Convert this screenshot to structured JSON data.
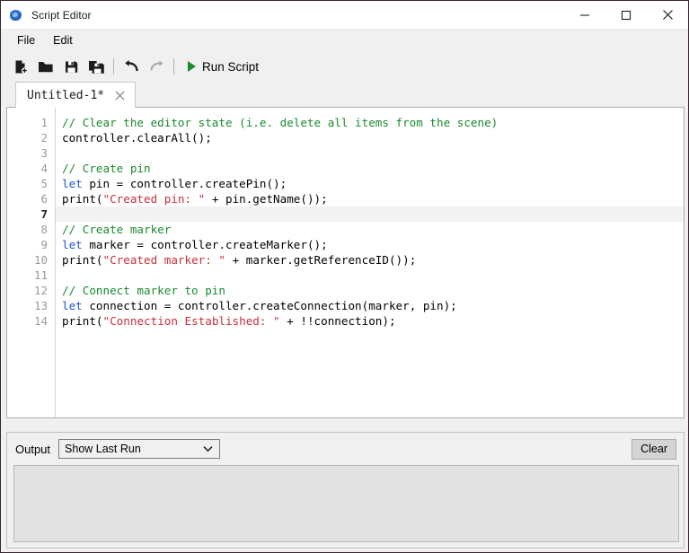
{
  "window": {
    "title": "Script Editor",
    "app_icon": "app-blob-icon",
    "controls": [
      {
        "name": "minimize",
        "glyph": "minimize-icon"
      },
      {
        "name": "maximize",
        "glyph": "maximize-icon"
      },
      {
        "name": "close",
        "glyph": "close-icon"
      }
    ]
  },
  "menubar": {
    "items": [
      {
        "label": "File"
      },
      {
        "label": "Edit"
      }
    ]
  },
  "toolbar": {
    "buttons": [
      {
        "name": "new-file-icon",
        "title": "New"
      },
      {
        "name": "open-folder-icon",
        "title": "Open"
      },
      {
        "name": "save-icon",
        "title": "Save"
      },
      {
        "name": "save-as-icon",
        "title": "Save As"
      },
      {
        "name": "undo-icon",
        "title": "Undo"
      },
      {
        "name": "redo-icon",
        "title": "Redo"
      }
    ],
    "run_label": "Run Script",
    "run_icon": "play-icon",
    "run_icon_color": "#1f8b2e"
  },
  "tabs": [
    {
      "label": "Untitled-1*",
      "modified": true,
      "close_icon": "close-icon",
      "active": true
    }
  ],
  "editor": {
    "active_line": 7,
    "line_numbers": [
      1,
      2,
      3,
      4,
      5,
      6,
      7,
      8,
      9,
      10,
      11,
      12,
      13,
      14
    ],
    "colors": {
      "comment": "#1a8a2e",
      "keyword": "#2255cc",
      "string": "#c8303a",
      "plain": "#000000",
      "active_line_bg": "#f2f2f2",
      "gutter_text": "#9a9a9a"
    },
    "lines": [
      {
        "n": 1,
        "tokens": [
          {
            "t": "com",
            "s": "// Clear the editor state (i.e. delete all items from the scene)"
          }
        ]
      },
      {
        "n": 2,
        "tokens": [
          {
            "t": "pln",
            "s": "controller.clearAll();"
          }
        ]
      },
      {
        "n": 3,
        "tokens": [
          {
            "t": "pln",
            "s": ""
          }
        ]
      },
      {
        "n": 4,
        "tokens": [
          {
            "t": "com",
            "s": "// Create pin"
          }
        ]
      },
      {
        "n": 5,
        "tokens": [
          {
            "t": "key",
            "s": "let"
          },
          {
            "t": "pln",
            "s": " pin = controller.createPin();"
          }
        ]
      },
      {
        "n": 6,
        "tokens": [
          {
            "t": "pln",
            "s": "print("
          },
          {
            "t": "str",
            "s": "\"Created pin: \""
          },
          {
            "t": "pln",
            "s": " + pin.getName());"
          }
        ]
      },
      {
        "n": 7,
        "tokens": [
          {
            "t": "pln",
            "s": ""
          }
        ]
      },
      {
        "n": 8,
        "tokens": [
          {
            "t": "com",
            "s": "// Create marker"
          }
        ]
      },
      {
        "n": 9,
        "tokens": [
          {
            "t": "key",
            "s": "let"
          },
          {
            "t": "pln",
            "s": " marker = controller.createMarker();"
          }
        ]
      },
      {
        "n": 10,
        "tokens": [
          {
            "t": "pln",
            "s": "print("
          },
          {
            "t": "str",
            "s": "\"Created marker: \""
          },
          {
            "t": "pln",
            "s": " + marker.getReferenceID());"
          }
        ]
      },
      {
        "n": 11,
        "tokens": [
          {
            "t": "pln",
            "s": ""
          }
        ]
      },
      {
        "n": 12,
        "tokens": [
          {
            "t": "com",
            "s": "// Connect marker to pin"
          }
        ]
      },
      {
        "n": 13,
        "tokens": [
          {
            "t": "key",
            "s": "let"
          },
          {
            "t": "pln",
            "s": " connection = controller.createConnection(marker, pin);"
          }
        ]
      },
      {
        "n": 14,
        "tokens": [
          {
            "t": "pln",
            "s": "print("
          },
          {
            "t": "str",
            "s": "\"Connection Established: \""
          },
          {
            "t": "pln",
            "s": " + !!connection);"
          }
        ]
      }
    ]
  },
  "output": {
    "label": "Output",
    "select_value": "Show Last Run",
    "select_options": [
      "Show Last Run"
    ],
    "chevron_icon": "chevron-down-icon",
    "clear_label": "Clear",
    "console_text": ""
  }
}
